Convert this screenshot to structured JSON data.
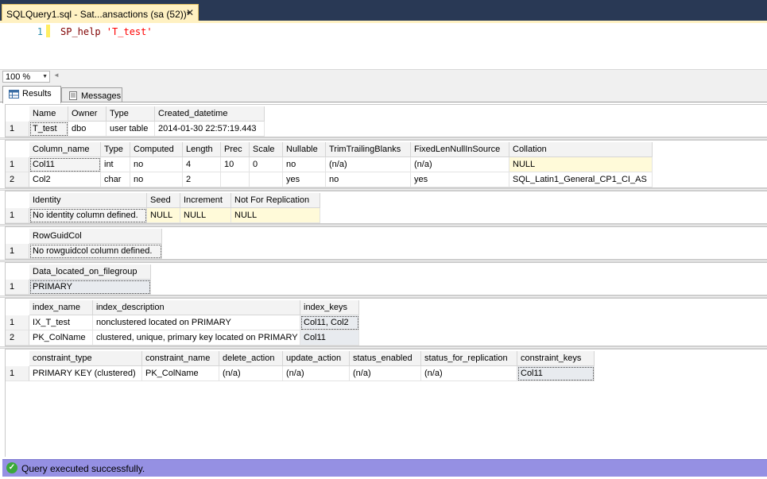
{
  "document_tab": {
    "title": "SQLQuery1.sql - Sat...ansactions (sa (52))*",
    "close": "✕"
  },
  "editor": {
    "line_number": "1",
    "code_keyword": "SP_help ",
    "code_string": "'T_test'"
  },
  "zoom": {
    "value": "100 %"
  },
  "result_tabs": [
    {
      "label": "Results"
    },
    {
      "label": "Messages"
    }
  ],
  "grid1": {
    "headers": [
      "Name",
      "Owner",
      "Type",
      "Created_datetime"
    ],
    "rows": [
      {
        "n": "1",
        "cells": [
          "T_test",
          "dbo",
          "user table",
          "2014-01-30 22:57:19.443"
        ]
      }
    ]
  },
  "grid2": {
    "headers": [
      "Column_name",
      "Type",
      "Computed",
      "Length",
      "Prec",
      "Scale",
      "Nullable",
      "TrimTrailingBlanks",
      "FixedLenNullInSource",
      "Collation"
    ],
    "rows": [
      {
        "n": "1",
        "cells": [
          "Col11",
          "int",
          "no",
          "4",
          "10",
          "0",
          "no",
          "(n/a)",
          "(n/a)",
          "NULL"
        ]
      },
      {
        "n": "2",
        "cells": [
          "Col2",
          "char",
          "no",
          "2",
          "",
          "",
          "yes",
          "no",
          "yes",
          "SQL_Latin1_General_CP1_CI_AS"
        ]
      }
    ]
  },
  "grid3": {
    "headers": [
      "Identity",
      "Seed",
      "Increment",
      "Not For Replication"
    ],
    "rows": [
      {
        "n": "1",
        "cells": [
          "No identity column defined.",
          "NULL",
          "NULL",
          "NULL"
        ]
      }
    ]
  },
  "grid4": {
    "headers": [
      "RowGuidCol"
    ],
    "rows": [
      {
        "n": "1",
        "cells": [
          "No rowguidcol column defined."
        ]
      }
    ]
  },
  "grid5": {
    "headers": [
      "Data_located_on_filegroup"
    ],
    "rows": [
      {
        "n": "1",
        "cells": [
          "PRIMARY"
        ]
      }
    ]
  },
  "grid6": {
    "headers": [
      "index_name",
      "index_description",
      "index_keys"
    ],
    "rows": [
      {
        "n": "1",
        "cells": [
          "IX_T_test",
          "nonclustered located on PRIMARY",
          "Col11, Col2"
        ]
      },
      {
        "n": "2",
        "cells": [
          "PK_ColName",
          "clustered, unique, primary key located on PRIMARY",
          "Col11"
        ]
      }
    ]
  },
  "grid7": {
    "headers": [
      "constraint_type",
      "constraint_name",
      "delete_action",
      "update_action",
      "status_enabled",
      "status_for_replication",
      "constraint_keys"
    ],
    "rows": [
      {
        "n": "1",
        "cells": [
          "PRIMARY KEY (clustered)",
          "PK_ColName",
          "(n/a)",
          "(n/a)",
          "(n/a)",
          "(n/a)",
          "Col11"
        ]
      }
    ]
  },
  "status": {
    "message": "Query executed successfully.",
    "icon": "check-circle-icon",
    "bar_color": "#9590e3"
  }
}
